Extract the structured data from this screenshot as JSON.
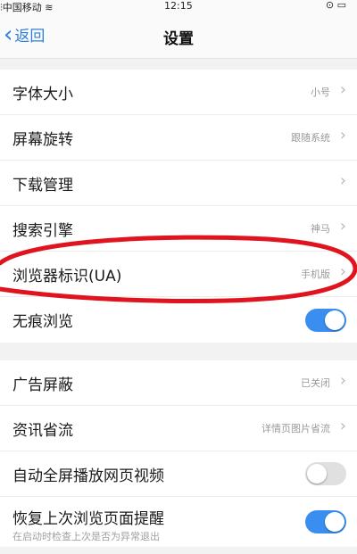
{
  "statusbar": {
    "carrier": "中国移动",
    "time": "12:15"
  },
  "navbar": {
    "back_label": "返回",
    "title": "设置"
  },
  "group1": [
    {
      "label": "字体大小",
      "value": "小号",
      "arrow": true
    },
    {
      "label": "屏幕旋转",
      "value": "跟随系统",
      "arrow": true
    },
    {
      "label": "下载管理",
      "value": "",
      "arrow": true
    },
    {
      "label": "搜索引擎",
      "value": "神马",
      "arrow": true
    },
    {
      "label": "浏览器标识(UA)",
      "value": "手机版",
      "arrow": true
    },
    {
      "label": "无痕浏览",
      "toggle": "on"
    }
  ],
  "group2": [
    {
      "label": "广告屏蔽",
      "value": "已关闭",
      "arrow": true
    },
    {
      "label": "资讯省流",
      "value": "详情页图片省流",
      "arrow": true
    },
    {
      "label": "自动全屏播放网页视频",
      "toggle": "off"
    },
    {
      "label": "恢复上次浏览页面提醒",
      "sub": "在启动时检查上次是否为异常退出",
      "toggle": "on"
    }
  ],
  "colors": {
    "accent": "#3a8ef0",
    "annotation": "#e0141e"
  },
  "icons": [
    "signal-icon",
    "wifi-icon",
    "alarm-icon",
    "battery-icon",
    "back-chevron-icon",
    "chevron-right-icon"
  ]
}
